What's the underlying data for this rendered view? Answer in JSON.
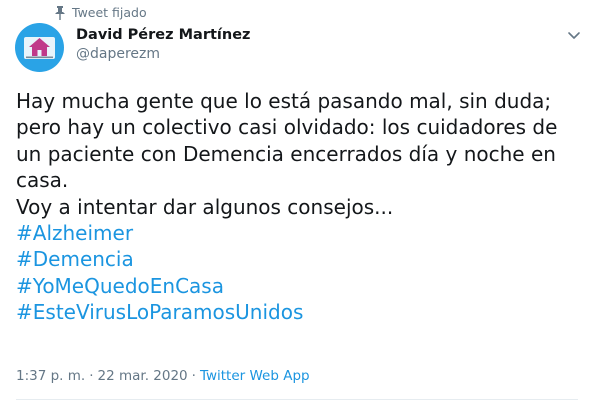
{
  "pinned": {
    "label": "Tweet fijado",
    "icon": "pin-icon"
  },
  "author": {
    "name": "David Pérez Martínez",
    "handle": "@daperezm",
    "avatar_icon": "house-logo-icon"
  },
  "menu": {
    "icon": "chevron-down-icon"
  },
  "tweet": {
    "lines": [
      "Hay mucha gente que lo está pasando mal, sin duda;",
      "pero hay un colectivo casi olvidado: los cuidadores de",
      "un paciente con Demencia encerrados día y noche en",
      "casa.",
      "Voy a intentar dar algunos consejos..."
    ],
    "hashtags": [
      "#Alzheimer",
      "#Demencia",
      "#YoMeQuedoEnCasa",
      "#EsteVirusLoParamosUnidos"
    ]
  },
  "meta": {
    "time": "1:37 p. m.",
    "separator1": "·",
    "date": "22 mar. 2020",
    "separator2": "·",
    "source": "Twitter Web App"
  },
  "colors": {
    "link": "#1b95e0",
    "secondary_text": "#657786",
    "avatar_bg": "#2aa3e6",
    "logo_house": "#c0398a"
  }
}
